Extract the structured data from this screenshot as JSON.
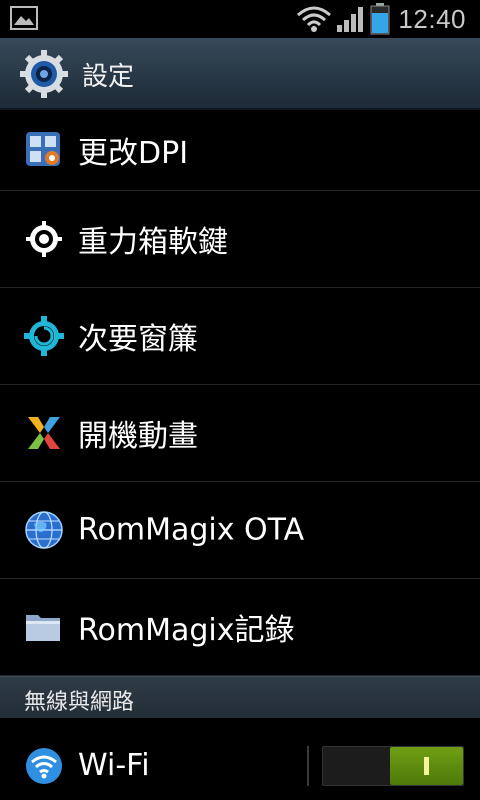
{
  "status_bar": {
    "time": "12:40",
    "icons": [
      "gallery-notification-icon",
      "wifi-signal-icon",
      "cell-signal-icon",
      "battery-icon"
    ]
  },
  "action_bar": {
    "icon": "settings-gear-icon",
    "title": "設定"
  },
  "list": {
    "items": [
      {
        "label": "更改DPI",
        "icon": "dpi-grid-icon"
      },
      {
        "label": "重力箱軟鍵",
        "icon": "gravity-gear-icon"
      },
      {
        "label": "次要窗簾",
        "icon": "secondary-curtain-gear-icon"
      },
      {
        "label": "開機動畫",
        "icon": "boot-animation-x-icon"
      },
      {
        "label": "RomMagix OTA",
        "icon": "globe-icon"
      },
      {
        "label": "RomMagix記錄",
        "icon": "folder-icon"
      }
    ]
  },
  "section": {
    "label": "無線與網路"
  },
  "wifi": {
    "label": "Wi-Fi",
    "icon": "wifi-icon",
    "enabled": true
  },
  "colors": {
    "accent_green": "#5a8a0e",
    "action_bar": "#2b3a48",
    "background": "#000000"
  }
}
